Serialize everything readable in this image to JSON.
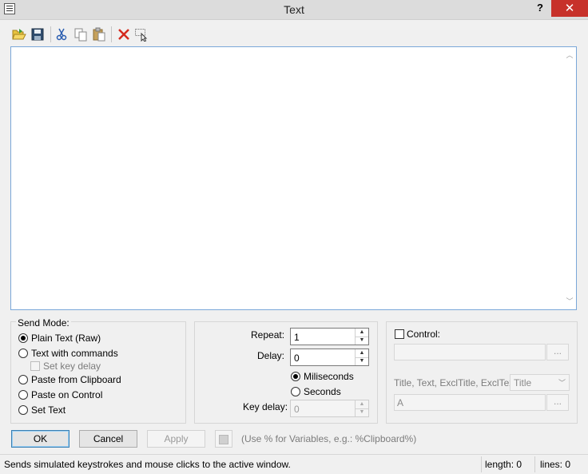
{
  "window": {
    "title": "Text",
    "help_label": "?",
    "close_label": "✕"
  },
  "toolbar": {
    "buttons": [
      "open-icon",
      "save-icon",
      "cut-icon",
      "copy-icon",
      "paste-icon",
      "delete-icon",
      "select-window-icon"
    ]
  },
  "editor": {
    "content": ""
  },
  "send_mode": {
    "legend": "Send Mode:",
    "options": [
      {
        "label": "Plain Text (Raw)",
        "checked": true
      },
      {
        "label": "Text with commands",
        "checked": false
      },
      {
        "label": "Paste from Clipboard",
        "checked": false
      },
      {
        "label": "Paste on Control",
        "checked": false
      },
      {
        "label": "Set Text",
        "checked": false
      }
    ],
    "set_key_delay_label": "Set key delay"
  },
  "timing": {
    "repeat_label": "Repeat:",
    "repeat_value": "1",
    "delay_label": "Delay:",
    "delay_value": "0",
    "unit_options": [
      {
        "label": "Miliseconds",
        "checked": true
      },
      {
        "label": "Seconds",
        "checked": false
      }
    ],
    "key_delay_label": "Key delay:",
    "key_delay_value": "0"
  },
  "control": {
    "checkbox_label": "Control:",
    "control_value": "",
    "browse_label": "...",
    "match_label": "Title, Text, ExclTitle, ExclText",
    "match_select_value": "Title",
    "window_value": "A",
    "window_browse_label": "..."
  },
  "buttons": {
    "ok": "OK",
    "cancel": "Cancel",
    "apply": "Apply"
  },
  "hint": "(Use % for Variables, e.g.: %Clipboard%)",
  "status": {
    "message": "Sends simulated keystrokes and mouse clicks to the active window.",
    "length": "length: 0",
    "lines": "lines: 0"
  },
  "colors": {
    "close_button": "#c7312a",
    "focus_border": "#7aa7d9",
    "default_button_border": "#3c7fb1"
  }
}
